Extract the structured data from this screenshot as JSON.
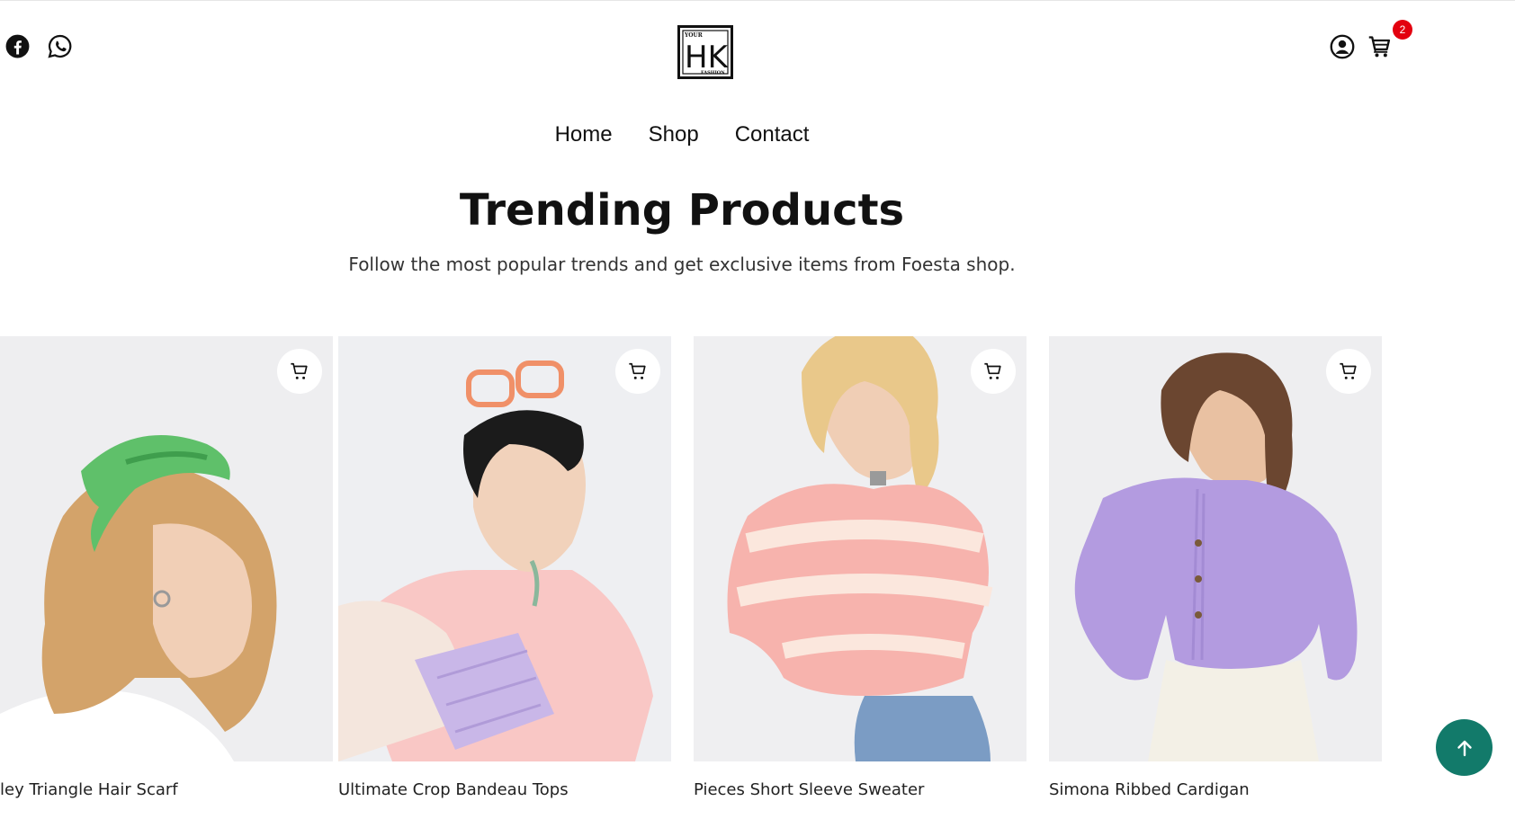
{
  "header": {
    "social": [
      {
        "icon": "facebook-icon"
      },
      {
        "icon": "whatsapp-icon"
      }
    ],
    "logo": {
      "big_letters": "HK",
      "top_text": "YOUR",
      "bottom_text": "FASHION"
    },
    "account_icon": "user-circle-icon",
    "cart": {
      "icon": "cart-icon",
      "count": "2",
      "badge_color": "#e3000f"
    }
  },
  "nav": {
    "items": [
      {
        "label": "Home"
      },
      {
        "label": "Shop"
      },
      {
        "label": "Contact"
      }
    ]
  },
  "section": {
    "title": "Trending Products",
    "subtitle": "Follow the most popular trends and get exclusive items from Foesta shop."
  },
  "products": [
    {
      "name": "ley Triangle Hair Scarf",
      "accent": "#5fc06a"
    },
    {
      "name": "Ultimate Crop Bandeau Tops",
      "accent": "#f6c4c4"
    },
    {
      "name": "Pieces Short Sleeve Sweater",
      "accent": "#f2a9a2"
    },
    {
      "name": "Simona Ribbed Cardigan",
      "accent": "#b39be0"
    }
  ],
  "scroll_top": {
    "icon": "arrow-up-icon",
    "color": "#127a6a"
  }
}
